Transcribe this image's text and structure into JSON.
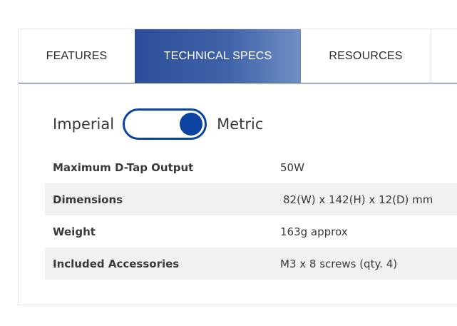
{
  "tabs": [
    {
      "label": "FEATURES",
      "active": false
    },
    {
      "label": "TECHNICAL SPECS",
      "active": true
    },
    {
      "label": "RESOURCES",
      "active": false
    }
  ],
  "units": {
    "left_label": "Imperial",
    "right_label": "Metric",
    "selected": "Metric"
  },
  "specs": [
    {
      "label": "Maximum D-Tap Output",
      "value": "50W"
    },
    {
      "label": "Dimensions",
      "value": "82(W) x 142(H) x 12(D) mm"
    },
    {
      "label": "Weight",
      "value": "163g approx"
    },
    {
      "label": "Included Accessories",
      "value": "M3 x 8 screws (qty. 4)"
    }
  ],
  "colors": {
    "accent": "#0a43a0",
    "active_tab_start": "#2c4e9a",
    "active_tab_end": "#6f8fc4",
    "stripe": "#f1f1f1"
  }
}
